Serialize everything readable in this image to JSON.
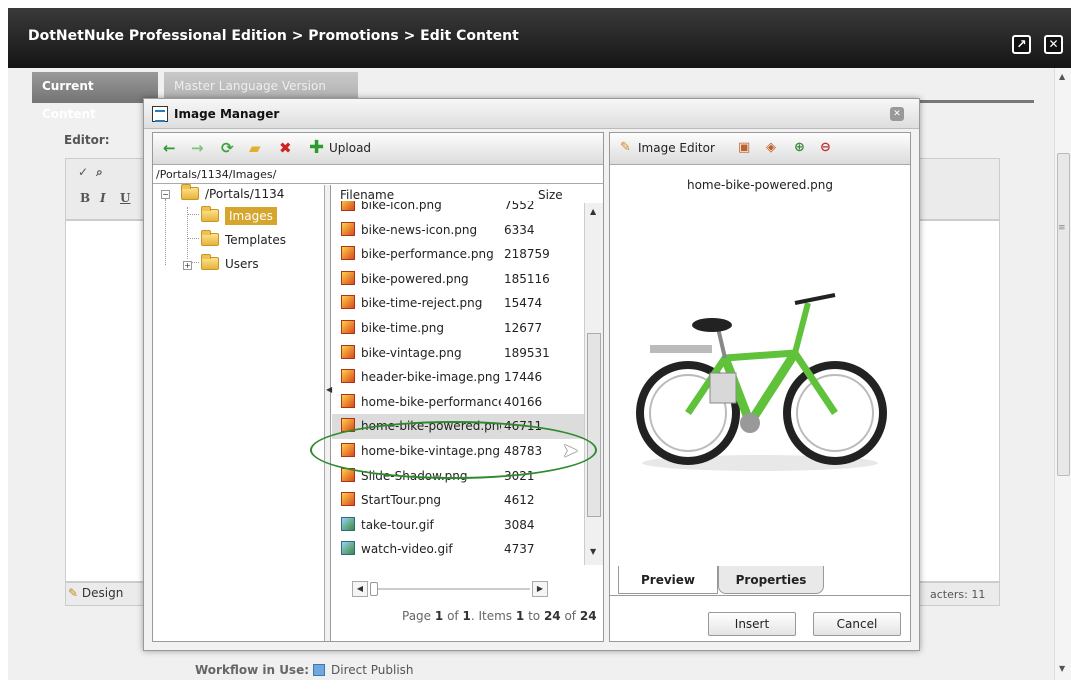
{
  "window": {
    "title": "DotNetNuke Professional Edition > Promotions > Edit Content",
    "maximize_icon": "maximize-icon",
    "close_icon": "close-icon"
  },
  "tabs": [
    {
      "label": "Current Content",
      "active": true
    },
    {
      "label": "Master Language Version",
      "active": false
    }
  ],
  "editor": {
    "label": "Editor:",
    "bold": "B",
    "italic": "I",
    "underline": "U",
    "design_tab": "Design",
    "char_count": "acters: 11"
  },
  "workflow": {
    "label": "Workflow in Use:",
    "value": "Direct Publish"
  },
  "image_manager": {
    "title": "Image Manager",
    "toolbar": {
      "upload_label": "Upload",
      "icons": [
        "back-icon",
        "forward-icon",
        "refresh-icon",
        "new-folder-icon",
        "delete-icon",
        "upload-icon"
      ]
    },
    "path": "/Portals/1134/Images/",
    "tree": {
      "root": "/Portals/1134",
      "children": [
        {
          "label": "Images",
          "selected": true
        },
        {
          "label": "Templates",
          "selected": false
        },
        {
          "label": "Users",
          "selected": false
        }
      ]
    },
    "columns": {
      "filename": "Filename",
      "size": "Size"
    },
    "files": [
      {
        "name": "bike-icon.png",
        "size": "7552",
        "type": "png"
      },
      {
        "name": "bike-news-icon.png",
        "size": "6334",
        "type": "png"
      },
      {
        "name": "bike-performance.png",
        "size": "218759",
        "type": "png"
      },
      {
        "name": "bike-powered.png",
        "size": "185116",
        "type": "png"
      },
      {
        "name": "bike-time-reject.png",
        "size": "15474",
        "type": "png"
      },
      {
        "name": "bike-time.png",
        "size": "12677",
        "type": "png"
      },
      {
        "name": "bike-vintage.png",
        "size": "189531",
        "type": "png"
      },
      {
        "name": "header-bike-image.png",
        "size": "17446",
        "type": "png"
      },
      {
        "name": "home-bike-performance.png",
        "size": "40166",
        "type": "png"
      },
      {
        "name": "home-bike-powered.png",
        "size": "46711",
        "type": "png",
        "selected": true
      },
      {
        "name": "home-bike-vintage.png",
        "size": "48783",
        "type": "png"
      },
      {
        "name": "Slide-Shadow.png",
        "size": "3021",
        "type": "png"
      },
      {
        "name": "StartTour.png",
        "size": "4612",
        "type": "png"
      },
      {
        "name": "take-tour.gif",
        "size": "3084",
        "type": "gif"
      },
      {
        "name": "watch-video.gif",
        "size": "4737",
        "type": "gif"
      }
    ],
    "pager": {
      "page_label": "Page",
      "page": "1",
      "of_label": "of",
      "pages": "1",
      "items_label": ". Items",
      "from": "1",
      "to_label": "to",
      "to": "24",
      "of2_label": "of",
      "total": "24"
    },
    "image_editor": {
      "label": "Image Editor",
      "selected_file": "home-bike-powered.png",
      "tabs": [
        "Preview",
        "Properties"
      ]
    },
    "buttons": {
      "insert": "Insert",
      "cancel": "Cancel"
    }
  }
}
